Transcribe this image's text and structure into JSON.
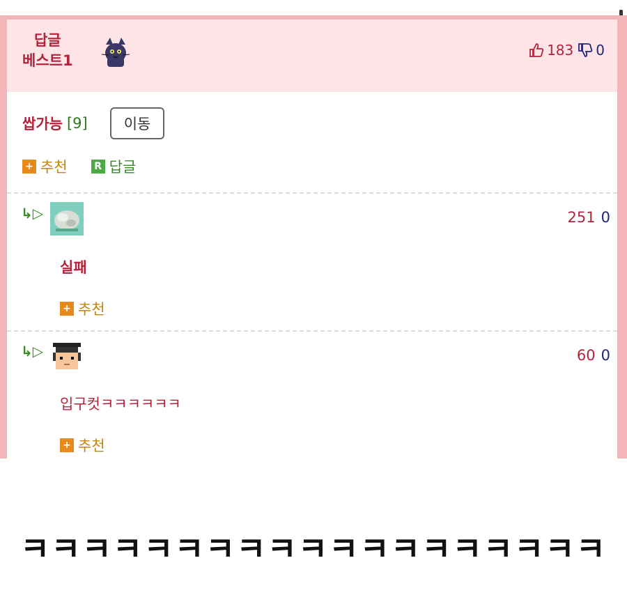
{
  "best": {
    "label_line1": "답글",
    "label_line2": "베스트1",
    "up_count": "183",
    "down_count": "0"
  },
  "post": {
    "title": "쌉가능",
    "reply_count": "[9]",
    "move_button": "이동"
  },
  "actions": {
    "recommend": "추천",
    "reply": "답글",
    "plus_glyph": "+",
    "r_glyph": "R"
  },
  "replies": [
    {
      "arrow": "↳▷",
      "score_up": "251",
      "score_down": "0",
      "text": "실패",
      "recommend": "추천"
    },
    {
      "arrow": "↳▷",
      "score_up": "60",
      "score_down": "0",
      "text": "입구컷ㅋㅋㅋㅋㅋㅋ",
      "recommend": "추천"
    }
  ],
  "caption": "ㅋㅋㅋㅋㅋㅋㅋㅋㅋㅋㅋㅋㅋㅋㅋㅋㅋㅋㅋ",
  "colors": {
    "accent_red": "#b3243c",
    "navy": "#23237a",
    "green": "#3b8a29",
    "orange": "#e8891c",
    "pink_frame": "#f4b5b9",
    "pink_bar": "#fde4e6"
  }
}
